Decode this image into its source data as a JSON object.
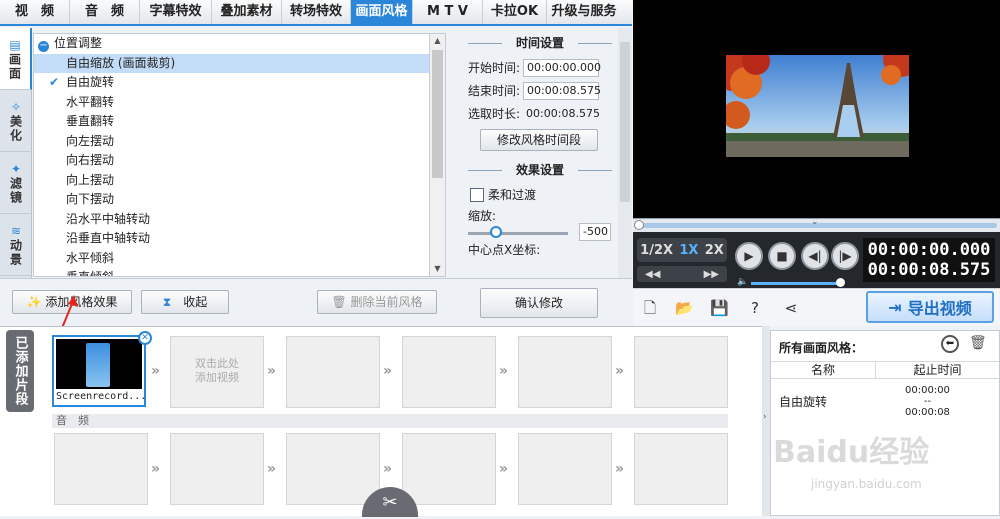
{
  "tabs": [
    "视　频",
    "音　频",
    "字幕特效",
    "叠加素材",
    "转场特效",
    "画面风格",
    "M T V",
    "卡拉OK",
    "升级与服务"
  ],
  "active_tab": "画面风格",
  "side_nav": [
    {
      "label": "画面",
      "icon": "frame-icon"
    },
    {
      "label": "美化",
      "icon": "beautify-icon"
    },
    {
      "label": "滤镜",
      "icon": "filter-icon"
    },
    {
      "label": "动景",
      "icon": "motion-icon"
    }
  ],
  "style_list": {
    "root": "位置调整",
    "items": [
      "自由缩放 (画面裁剪)",
      "自由旋转",
      "水平翻转",
      "垂直翻转",
      "向左摆动",
      "向右摆动",
      "向上摆动",
      "向下摆动",
      "沿水平中轴转动",
      "沿垂直中轴转动",
      "水平倾斜",
      "垂直倾斜"
    ],
    "selected": "自由缩放 (画面裁剪)",
    "checked": "自由旋转"
  },
  "time_settings": {
    "title": "时间设置",
    "start_label": "开始时间:",
    "start_value": "00:00:00.000",
    "end_label": "结束时间:",
    "end_value": "00:00:08.575",
    "duration_label": "选取时长:",
    "duration_value": "00:00:08.575",
    "modify_button": "修改风格时间段"
  },
  "effect_settings": {
    "title": "效果设置",
    "soft_transition": "柔和过渡",
    "zoom_label": "缩放:",
    "zoom_value": "-500",
    "center_label": "中心点X坐标:"
  },
  "buttons": {
    "add_style": "添加风格效果",
    "collapse": "收起",
    "delete_style": "删除当前风格",
    "confirm": "确认修改"
  },
  "player": {
    "speeds": [
      "1/2X",
      "1X",
      "2X"
    ],
    "active_speed": "1X",
    "current_time": "00:00:00.000",
    "total_time": "00:00:08.575",
    "export": "导出视频"
  },
  "clips": {
    "tab": "已添加片段",
    "clip_name": "Screenrecord...",
    "placeholder": "双击此处\n添加视频",
    "audio_label": "音　频"
  },
  "applied_styles": {
    "title": "所有画面风格：",
    "col_name": "名称",
    "col_time": "起止时间",
    "rows": [
      {
        "name": "自由旋转",
        "start": "00:00:00",
        "sep": "--",
        "end": "00:00:08"
      }
    ]
  },
  "watermark": "Baidu经验",
  "watermark_url": "jingyan.baidu.com",
  "colors": {
    "accent": "#2a86d8",
    "selected_row": "#c3dcf7",
    "player_bg": "#24272b"
  }
}
